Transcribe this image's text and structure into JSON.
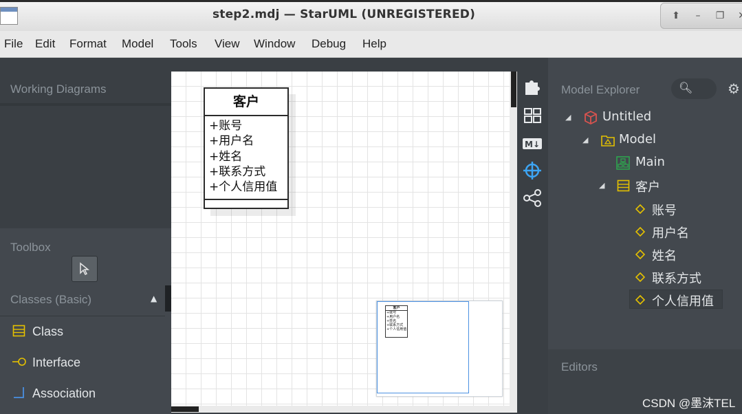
{
  "window": {
    "title": "step2.mdj — StarUML (UNREGISTERED)"
  },
  "menu": [
    "File",
    "Edit",
    "Format",
    "Model",
    "Tools",
    "View",
    "Window",
    "Debug",
    "Help"
  ],
  "sidebar": {
    "working_diagrams": "Working Diagrams",
    "toolbox": "Toolbox",
    "classes_section": "Classes (Basic)",
    "tools": [
      {
        "label": "Class",
        "icon": "class-icon"
      },
      {
        "label": "Interface",
        "icon": "interface-icon"
      },
      {
        "label": "Association",
        "icon": "association-icon"
      }
    ]
  },
  "diagram": {
    "class_name": "客户",
    "attributes": [
      "+账号",
      "+用户名",
      "+姓名",
      "+联系方式",
      "+个人信用值"
    ]
  },
  "explorer": {
    "title": "Model Explorer",
    "tree": [
      {
        "label": "Untitled",
        "icon": "project-cube-icon"
      },
      {
        "label": "Model",
        "icon": "model-package-icon"
      },
      {
        "label": "Main",
        "icon": "diagram-icon"
      },
      {
        "label": "客户",
        "icon": "class-icon"
      },
      {
        "label": "账号",
        "icon": "attribute-icon"
      },
      {
        "label": "用户名",
        "icon": "attribute-icon"
      },
      {
        "label": "姓名",
        "icon": "attribute-icon"
      },
      {
        "label": "联系方式",
        "icon": "attribute-icon"
      },
      {
        "label": "个人信用值",
        "icon": "attribute-icon"
      }
    ],
    "selected": "个人信用值"
  },
  "editors": {
    "title": "Editors"
  },
  "watermark": "CSDN @墨沫TEL",
  "colors": {
    "accent_yellow": "#e5c100",
    "project_red": "#d9534f",
    "diagram_green": "#2ea44f",
    "minimap_view": "#4a90e2"
  }
}
